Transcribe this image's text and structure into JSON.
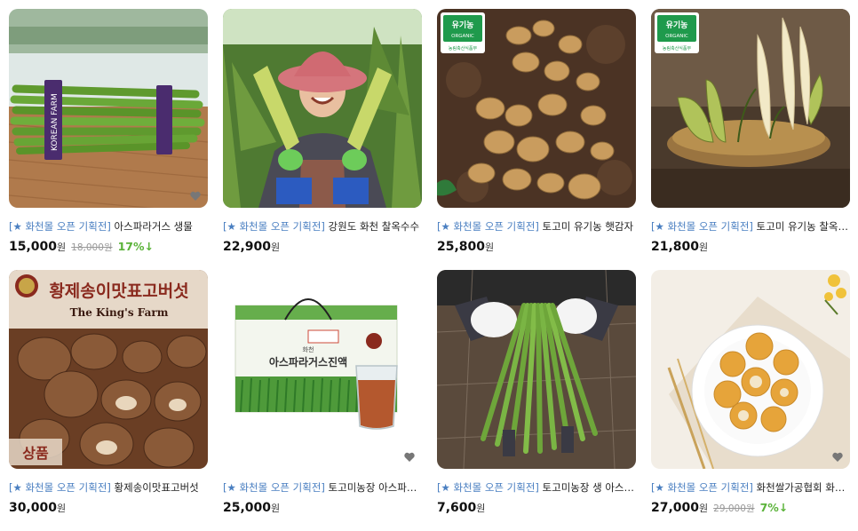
{
  "products": [
    {
      "promo": "[★ 화천몰 오픈 기획전]",
      "name": "아스파라거스 생물",
      "price": "15,000",
      "unit": "원",
      "original_price": "18,000원",
      "discount": "17%↓",
      "label_text": "KOREAN FARM"
    },
    {
      "promo": "[★ 화천몰 오픈 기획전]",
      "name": "강원도 화천 찰옥수수",
      "price": "22,900",
      "unit": "원"
    },
    {
      "promo": "[★ 화천몰 오픈 기획전]",
      "name": "토고미 유기농 햇감자",
      "price": "25,800",
      "unit": "원",
      "badge_main": "유기농",
      "badge_sub": "ORGANIC",
      "badge_caption": "농림축산식품부"
    },
    {
      "promo": "[★ 화천몰 오픈 기획전]",
      "name": "토고미 유기농 찰옥수수",
      "price": "21,800",
      "unit": "원",
      "badge_main": "유기농",
      "badge_sub": "ORGANIC",
      "badge_caption": "농림축산식품부"
    },
    {
      "promo": "[★ 화천몰 오픈 기획전]",
      "name": "황제송이맛표고버섯",
      "price": "30,000",
      "unit": "원",
      "banner_title": "황제송이맛표고버섯",
      "banner_sub": "The King's Farm",
      "grade_label": "상품"
    },
    {
      "promo": "[★ 화천몰 오픈 기획전]",
      "name": "토고미농장 아스파라거스 진액",
      "price": "25,000",
      "unit": "원",
      "box_brand": "화천",
      "box_title": "아스파라거스진액"
    },
    {
      "promo": "[★ 화천몰 오픈 기획전]",
      "name": "토고미농장 생 아스파라거스",
      "price": "7,600",
      "unit": "원"
    },
    {
      "promo": "[★ 화천몰 오픈 기획전]",
      "name": "화천쌀가공협회 화천 쌀쿠키",
      "price": "27,000",
      "unit": "원",
      "original_price": "29,000원",
      "discount": "7%↓"
    }
  ],
  "colors": {
    "promo_text": "#4a7fc1",
    "discount": "#5bb33a",
    "original_price": "#999999"
  },
  "icons": {
    "wishlist": "heart-icon"
  }
}
